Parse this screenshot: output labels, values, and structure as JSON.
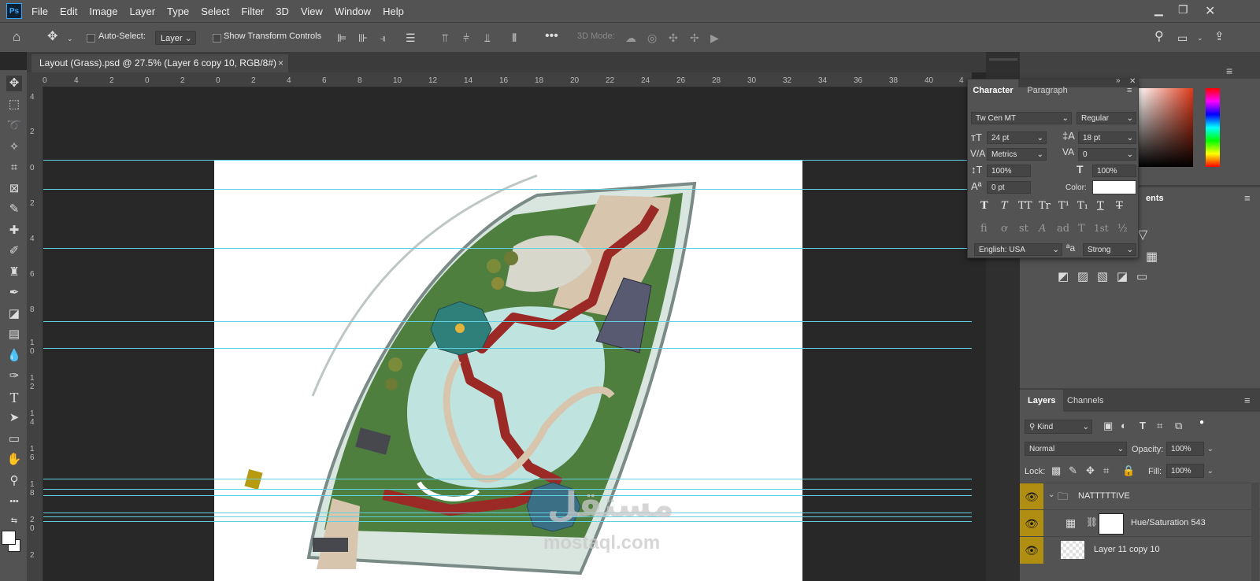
{
  "menu": {
    "logo": "Ps",
    "items": [
      "File",
      "Edit",
      "Image",
      "Layer",
      "Type",
      "Select",
      "Filter",
      "3D",
      "View",
      "Window",
      "Help"
    ]
  },
  "options": {
    "auto_select_label": "Auto-Select:",
    "auto_select_value": "Layer",
    "transform_label": "Show Transform Controls",
    "mode_3d_label": "3D Mode:"
  },
  "document": {
    "tab_title": "Layout (Grass).psd @ 27.5% (Layer 6 copy 10, RGB/8#)",
    "close": "×"
  },
  "rulers": {
    "h": [
      "0",
      "4",
      "2",
      "0",
      "2",
      "4",
      "6",
      "8",
      "10",
      "12",
      "14",
      "16",
      "18",
      "20",
      "22",
      "24",
      "26",
      "28",
      "30",
      "32",
      "34",
      "36",
      "38",
      "40",
      "4"
    ],
    "v": [
      "4",
      "2",
      "0",
      "2",
      "4",
      "6",
      "8",
      "1",
      "0",
      "1",
      "2",
      "1",
      "4",
      "1",
      "6",
      "1",
      "8",
      "2",
      "0",
      "2"
    ]
  },
  "watermark": {
    "arabic": "مستقل",
    "latin": "mostaql.com"
  },
  "character": {
    "tabs": [
      "Character",
      "Paragraph"
    ],
    "font_family": "Tw Cen MT",
    "font_style": "Regular",
    "size": "24 pt",
    "leading": "18 pt",
    "kerning": "Metrics",
    "tracking": "0",
    "vscale": "100%",
    "hscale": "100%",
    "baseline": "0 pt",
    "color_label": "Color:",
    "color_value": "#ffffff",
    "language": "English: USA",
    "aa_label": "a",
    "antialias": "Strong",
    "style_glyphs": [
      "T",
      "T",
      "TT",
      "Tr",
      "T¹",
      "T₁",
      "T",
      "T"
    ],
    "ot_glyphs": [
      "fi",
      "ơ",
      "st",
      "A",
      "ad",
      "T",
      "1st",
      "½"
    ]
  },
  "panels": {
    "adjustments_tab": "ents",
    "layers_tabs": [
      "Layers",
      "Channels"
    ],
    "kind_label": "Kind",
    "blend_mode": "Normal",
    "opacity_label": "Opacity:",
    "opacity_value": "100%",
    "lock_label": "Lock:",
    "fill_label": "Fill:",
    "fill_value": "100%"
  },
  "layers": [
    {
      "name": "NATTTTTIVE",
      "type": "group"
    },
    {
      "name": "Hue/Saturation 543",
      "type": "adjustment"
    },
    {
      "name": "Layer 11 copy 10",
      "type": "pixel"
    }
  ],
  "colors": {
    "ui_bg": "#535353",
    "canvas_bg": "#282828",
    "guide": "#61d0e0",
    "layer_eye": "#b08e12",
    "path_red": "#9b2a27",
    "water": "#bfe3df",
    "grass": "#4f7f3e"
  }
}
